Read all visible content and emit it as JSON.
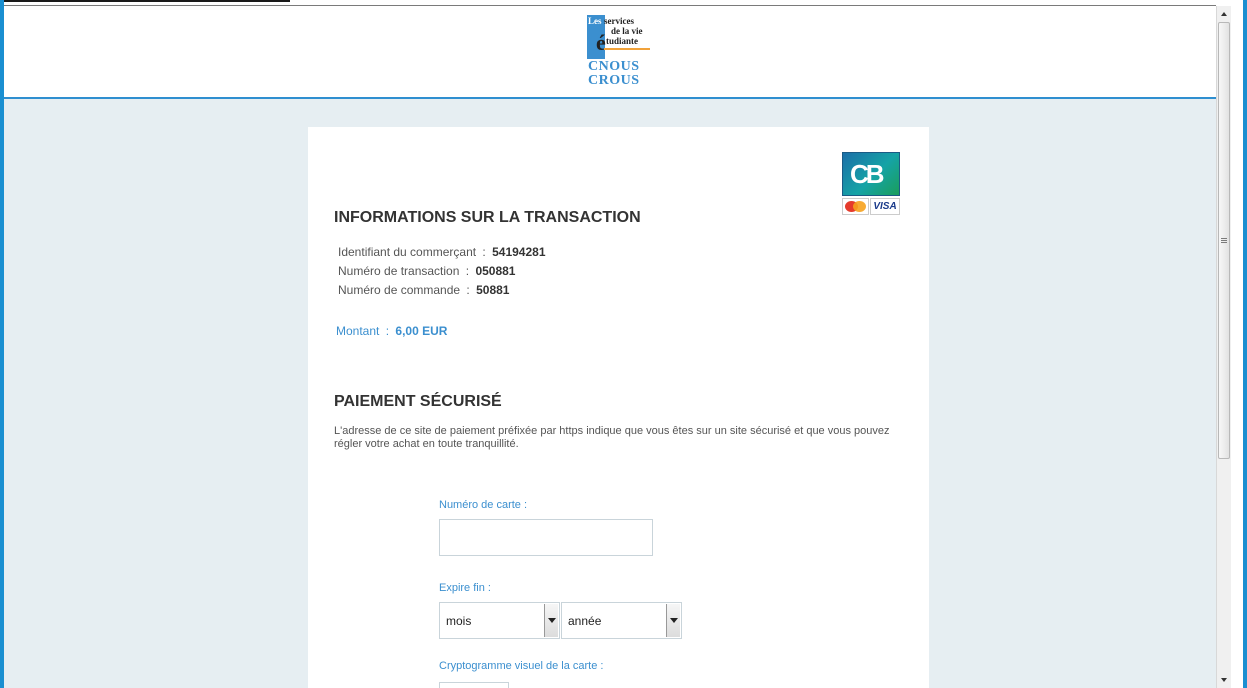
{
  "header": {
    "logo": {
      "les": "Les",
      "line1": "services",
      "line2": "de la vie",
      "line3_initial": "é",
      "line3_rest": "tudiante",
      "cnous": "CNOUS",
      "crous": "CROUS"
    }
  },
  "payment_brands": {
    "cb_label": "CB",
    "mastercard_label": "MasterCard",
    "visa_label": "VISA"
  },
  "transaction": {
    "title": "INFORMATIONS SUR LA TRANSACTION",
    "merchant_label": "Identifiant du commerçant",
    "merchant_value": "54194281",
    "transaction_label": "Numéro de transaction",
    "transaction_value": "050881",
    "order_label": "Numéro de commande",
    "order_value": "50881",
    "separator": ":",
    "amount_label": "Montant",
    "amount_value": "6,00 EUR"
  },
  "secure_payment": {
    "title": "PAIEMENT SÉCURISÉ",
    "note": "L'adresse de ce site de paiement préfixée par https indique que vous êtes sur un site sécurisé et que vous pouvez régler votre achat en toute tranquillité.",
    "card_number_label": "Numéro de carte :",
    "card_number_value": "",
    "expiry_label": "Expire fin :",
    "month_selected": "mois",
    "year_selected": "année",
    "cvv_label": "Cryptogramme visuel de la carte :",
    "cvv_value": ""
  },
  "colors": {
    "frame_blue": "#1a8fd1",
    "accent_blue": "#3b8fcf",
    "page_bg": "#e6eef2"
  }
}
